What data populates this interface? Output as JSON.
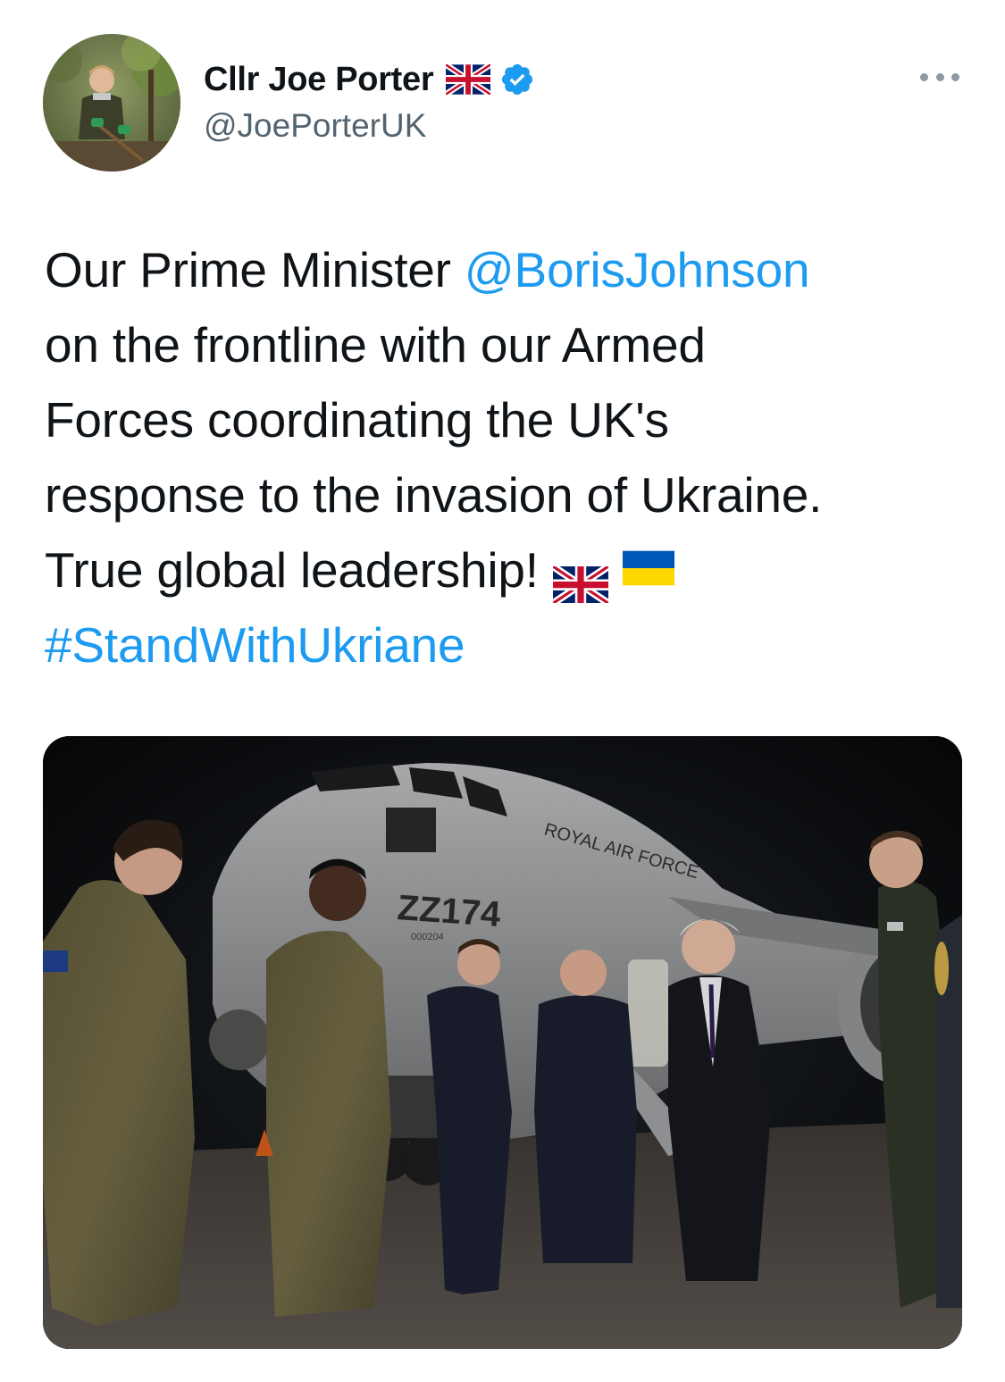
{
  "author": {
    "display_name": "Cllr Joe Porter",
    "handle": "@JoePorterUK",
    "name_flag_icon": "uk-flag-icon",
    "verified_icon": "verified-badge-icon",
    "avatar_icon": "avatar-photo"
  },
  "menu": {
    "more_icon": "more-options-icon"
  },
  "tweet": {
    "line1_prefix": "Our Prime Minister ",
    "line1_mention": "@BorisJohnson",
    "line2": "on the frontline with our Armed",
    "line3": "Forces coordinating the UK's",
    "line4": "response to the invasion of Ukraine.",
    "line5": "True global leadership!",
    "line5_flags": [
      "uk-flag-icon",
      "ukraine-flag-icon"
    ],
    "hashtag": "#StandWithUkriane"
  },
  "media": {
    "aircraft_serial": "ZZ174",
    "aircraft_subserial": "000204",
    "aircraft_marking": "ROYAL AIR FORCE"
  },
  "colors": {
    "link": "#1d9bf0",
    "text": "#0f1419",
    "secondary": "#536471",
    "verified": "#1d9bf0"
  }
}
